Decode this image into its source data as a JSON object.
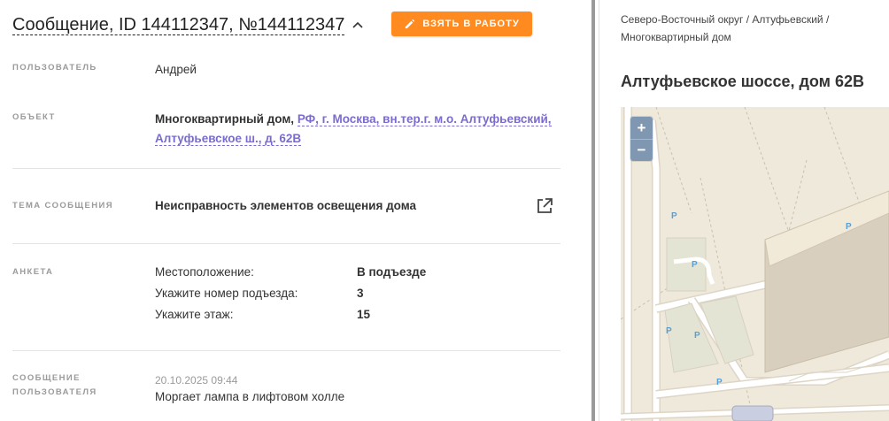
{
  "header": {
    "title": "Сообщение, ID 144112347, №144112347",
    "take_button": "ВЗЯТЬ В РАБОТУ"
  },
  "fields": {
    "user_label": "ПОЛЬЗОВАТЕЛЬ",
    "user_value": "Андрей",
    "object_label": "ОБЪЕКТ",
    "object_type": "Многоквартирный дом,",
    "object_address_line1": "РФ, г. Москва, вн.тер.г. м.о. Алтуфьевский,",
    "object_address_line2": "Алтуфьевское ш., д. 62В",
    "topic_label": "ТЕМА СООБЩЕНИЯ",
    "topic_value": "Неисправность элементов освещения дома",
    "survey_label": "АНКЕТА",
    "survey": [
      {
        "question": "Местоположение:",
        "answer": "В подъезде"
      },
      {
        "question": "Укажите номер подъезда:",
        "answer": "3"
      },
      {
        "question": "Укажите этаж:",
        "answer": "15"
      }
    ],
    "message_label_line1": "СООБЩЕНИЕ",
    "message_label_line2": "ПОЛЬЗОВАТЕЛЯ",
    "message_date": "20.10.2025 09:44",
    "message_text": "Моргает лампа в лифтовом холле"
  },
  "sidebar": {
    "breadcrumb_line1": "Северо-Восточный округ / Алтуфьевский /",
    "breadcrumb_line2": "Многоквартирный дом",
    "address_title": "Алтуфьевское шоссе, дом 62В",
    "zoom_in": "+",
    "zoom_out": "−",
    "parking_label": "P"
  },
  "colors": {
    "accent": "#ff8a1f",
    "link": "#7a6ccf",
    "map_background": "#efe9dc"
  },
  "icons": {
    "chevron": "chevron-up-icon",
    "pencil": "pencil-icon",
    "external": "external-link-icon"
  }
}
